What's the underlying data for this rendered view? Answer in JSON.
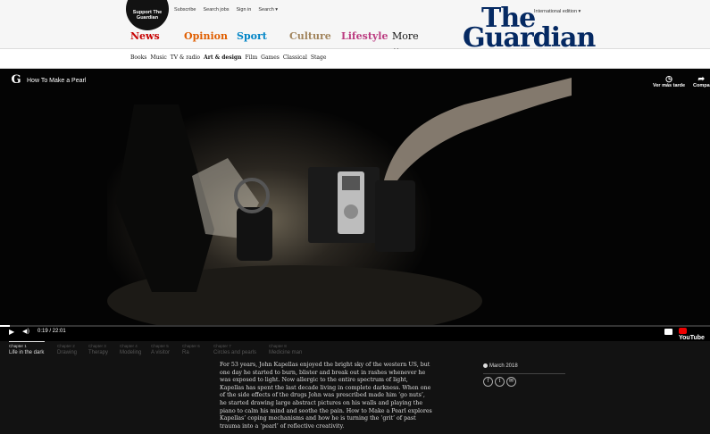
{
  "header": {
    "support_label": "Support The Guardian",
    "top_links": [
      "Subscribe",
      "Search jobs",
      "Sign in",
      "Search ▾"
    ],
    "edition": "International edition ▾",
    "logo_line1": "The",
    "logo_line2": "Guardian",
    "pillars": [
      "News",
      "Opinion",
      "Sport",
      "Culture",
      "Lifestyle",
      "More ⌄"
    ]
  },
  "subnav": {
    "items": [
      "Books",
      "Music",
      "TV & radio",
      "Art & design",
      "Film",
      "Games",
      "Classical",
      "Stage"
    ],
    "active": "Art & design"
  },
  "video": {
    "title": "How To Make a Pearl",
    "watch_later": "Ver más tarde",
    "share": "Compa",
    "time": "0:19 / 22:01",
    "progress": 0.014,
    "youtube_label": "YouTube"
  },
  "chapters": [
    {
      "num": "Chapter 1",
      "title": "Life in the dark"
    },
    {
      "num": "Chapter 2",
      "title": "Drawing"
    },
    {
      "num": "Chapter 3",
      "title": "Therapy"
    },
    {
      "num": "Chapter 4",
      "title": "Modeling"
    },
    {
      "num": "Chapter 5",
      "title": "A visitor"
    },
    {
      "num": "Chapter 6",
      "title": "Ra"
    },
    {
      "num": "Chapter 7",
      "title": "Circles and pearls"
    },
    {
      "num": "Chapter 8",
      "title": "Medicine man"
    }
  ],
  "article": {
    "standfirst": "For 53 years, John Kapellas enjoyed the bright sky of the western US, but one day he started to burn, blister and break out in rashes whenever he was exposed to light. Now allergic to the entire spectrum of light, Kapellas has spent the last decade living in complete darkness. When one of the side effects of the drugs John was prescribed made him ‘go nuts’, he started drawing large abstract pictures on his walls and playing the piano to calm his mind and soothe the pain. How to Make a Pearl explores Kapellas’ coping mechanisms and how he is turning the ‘grit’ of past trauma into a ‘pearl’ of reflective creativity.",
    "date": "March 2018",
    "share_icons": [
      "f",
      "t",
      "✉"
    ]
  }
}
